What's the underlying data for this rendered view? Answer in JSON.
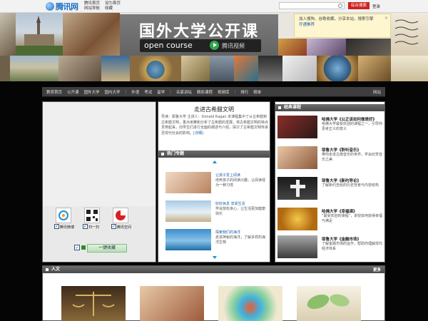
{
  "topbar": {
    "logo_text": "腾讯网",
    "links": [
      "腾讯首页",
      "设为首页",
      "网站导航",
      "收藏"
    ],
    "search_placeholder": "",
    "search_button": "综合搜索",
    "login": "登录"
  },
  "banner": {
    "title": "国外大学公开课",
    "subtitle": "open course",
    "tv_label": "腾讯视频",
    "notice": {
      "text": "加入搜狗、谷歌收藏，分享本站，搜索引擎",
      "link": "开通推荐",
      "close": "×"
    }
  },
  "nav": {
    "items": [
      "教育首页",
      "公开课",
      "国外大学",
      "国内大学",
      "外语",
      "考试",
      "留学",
      "名家讲坛",
      "精彩课程",
      "视频库",
      "排行",
      "榜单"
    ],
    "right": "网站"
  },
  "left": {
    "share": [
      {
        "label": "腾讯微博",
        "checked": true
      },
      {
        "label": "扫一扫",
        "checked": true
      },
      {
        "label": "腾讯空间",
        "checked": true
      }
    ],
    "bookmark_button": "一键收藏",
    "bookmark_checked": true
  },
  "middle": {
    "title": "走进古希腊文明",
    "intro": "导读：耶鲁大学 主讲人：Donald Kagan 本课程集中了从古希腊到古希腊文明，重点考察和分析了古希腊的发展，将古希腊文明的特点贯穿起来，向学生们进行全面的阐述与介绍，探讨了古希腊文明传承至现代社会的影响。",
    "more": "[详细]",
    "hot_title": "热门专题",
    "hot": [
      {
        "title": "让孩子爱上阅读",
        "desc": "培养孩子的阅读兴趣，让阅读成为一种习惯"
      },
      {
        "title": "好好休息 享受生活",
        "desc": "学会放松身心，让生活更加健康快乐"
      },
      {
        "title": "探索我们的海洋",
        "desc": "走进神秘的海洋，了解多样的海洋生物"
      }
    ]
  },
  "right": {
    "title": "经典课程",
    "courses": [
      {
        "title": "哈佛大学《公正该如何做是好》",
        "desc": "哈佛大学最受欢迎的课程之一，引导你思考正义的意义"
      },
      {
        "title": "耶鲁大学《聆听音乐》",
        "desc": "带你走进古典音乐的世界，学会欣赏音乐之美"
      },
      {
        "title": "耶鲁大学《新约导论》",
        "desc": "了解新约圣经的历史背景与内容结构"
      },
      {
        "title": "哈佛大学《幸福课》",
        "desc": "“最受欢迎的课程”，讲授如何获得幸福与满足"
      },
      {
        "title": "耶鲁大学《金融市场》",
        "desc": "了解金融市场的运作，帮助你理解现代经济体系"
      }
    ]
  },
  "bottom": {
    "title": "人文",
    "more": "更多"
  }
}
